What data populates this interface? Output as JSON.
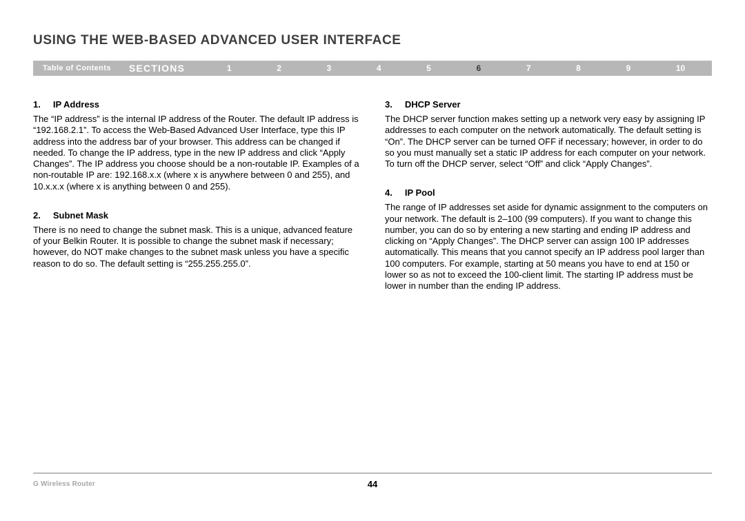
{
  "title": "USING THE WEB-BASED ADVANCED USER INTERFACE",
  "nav": {
    "toc": "Table of Contents",
    "sections_label": "SECTIONS",
    "numbers": [
      "1",
      "2",
      "3",
      "4",
      "5",
      "6",
      "7",
      "8",
      "9",
      "10"
    ],
    "active_index": 5
  },
  "left_col": [
    {
      "num": "1.",
      "title": "IP Address",
      "body": "The “IP address” is the internal IP address of the Router. The default IP address is “192.168.2.1”. To access the Web-Based Advanced User Interface, type this IP address into the address bar of your browser. This address can be changed if needed. To change the IP address, type in the new IP address and click “Apply Changes”. The IP address you choose should be a non-routable IP. Examples of a non-routable IP are: 192.168.x.x (where x is anywhere between 0 and 255), and 10.x.x.x (where x is anything between 0 and 255)."
    },
    {
      "num": "2.",
      "title": "Subnet Mask",
      "body": "There is no need to change the subnet mask. This is a unique, advanced feature of your Belkin Router. It is possible to change the subnet mask if necessary; however, do NOT make changes to the subnet mask unless you have a specific reason to do so. The default setting is “255.255.255.0”."
    }
  ],
  "right_col": [
    {
      "num": "3.",
      "title": "DHCP Server",
      "body": "The DHCP server function makes setting up a network very easy by assigning IP addresses to each computer on the network automatically. The default setting is “On”. The DHCP server can be turned OFF if necessary; however, in order to do so you must manually set a static IP address for each computer on your network. To turn off the DHCP server, select “Off” and click “Apply Changes”."
    },
    {
      "num": "4.",
      "title": "IP Pool",
      "body": "The range of IP addresses set aside for dynamic assignment to the computers on your network. The default is 2–100 (99 computers). If you want to change this number, you can do so by entering a new starting and ending IP address and clicking on “Apply Changes”. The DHCP server can assign 100 IP addresses automatically. This means that you cannot specify an IP address pool larger than 100 computers. For example, starting at 50 means you have to end at 150 or lower so as not to exceed the 100-client limit. The starting IP address must be lower in number than the ending IP address."
    }
  ],
  "footer": {
    "left": "G Wireless Router",
    "page": "44"
  }
}
